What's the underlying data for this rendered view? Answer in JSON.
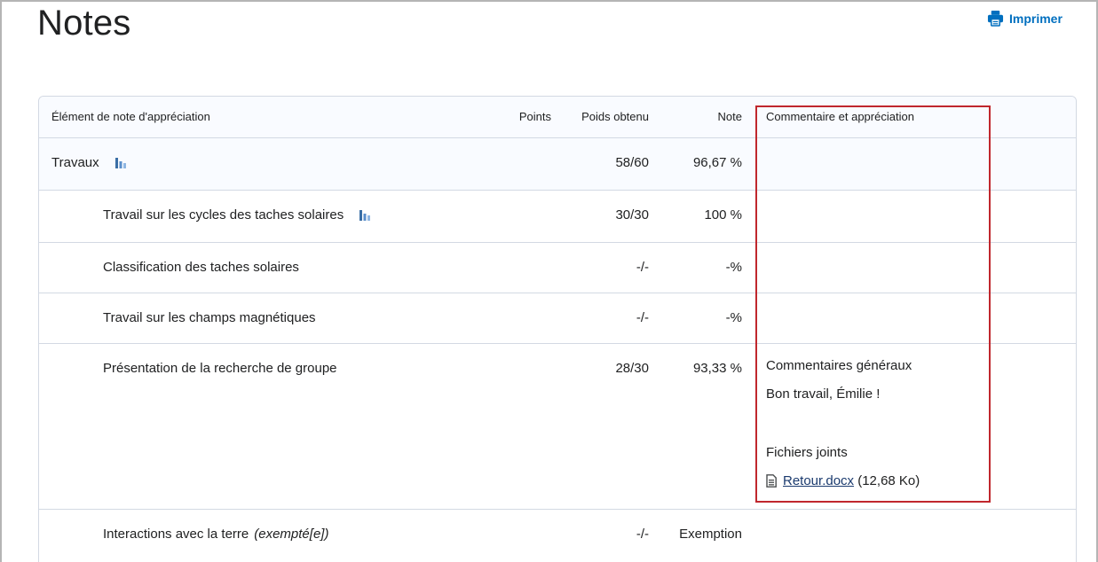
{
  "page": {
    "title": "Notes",
    "print_label": "Imprimer"
  },
  "table": {
    "columns": {
      "item": "Élément de note d'appréciation",
      "points": "Points",
      "weight": "Poids obtenu",
      "grade": "Note",
      "comments": "Commentaire et appréciation"
    },
    "rows": [
      {
        "name": "Travaux",
        "points": "",
        "weight": "58/60",
        "grade": "96,67 %",
        "is_category": true
      },
      {
        "name": "Travail sur les cycles des taches solaires",
        "points": "",
        "weight": "30/30",
        "grade": "100 %"
      },
      {
        "name": "Classification des taches solaires",
        "points": "",
        "weight": "-/-",
        "grade": "-%"
      },
      {
        "name": "Travail sur les champs magnétiques",
        "points": "",
        "weight": "-/-",
        "grade": "-%"
      },
      {
        "name": "Présentation de la recherche de groupe",
        "points": "",
        "weight": "28/30",
        "grade": "93,33 %",
        "comments": {
          "general_label": "Commentaires généraux",
          "general_text": "Bon travail, Émilie !",
          "attachments_label": "Fichiers joints",
          "file_name": "Retour.docx",
          "file_size": "(12,68 Ko)"
        }
      },
      {
        "name": "Interactions avec la terre",
        "exempt_tag": "(exempté[e])",
        "points": "",
        "weight": "-/-",
        "grade": "Exemption"
      }
    ]
  },
  "colors": {
    "accent": "#006fbf",
    "highlight": "#c0272d",
    "row_tint": "#f9fbff",
    "border": "#d3d9e3"
  }
}
